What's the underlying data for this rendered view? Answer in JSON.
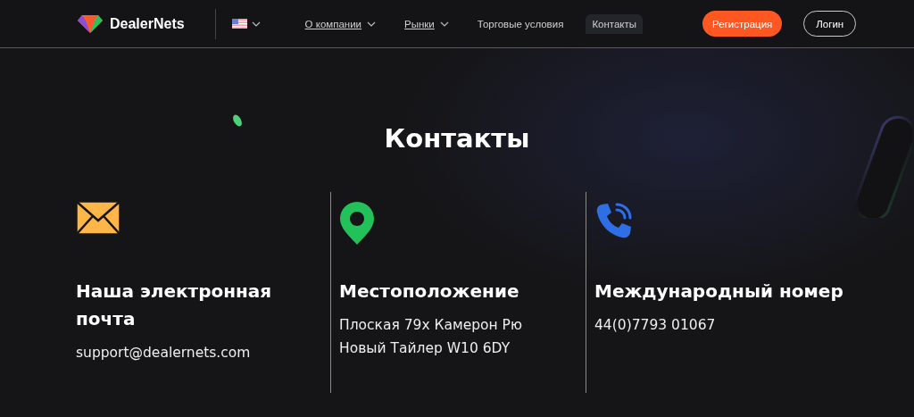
{
  "header": {
    "brand": "DealerNets",
    "nav": [
      {
        "label": "О компании",
        "dropdown": true,
        "selected": false
      },
      {
        "label": "Рынки",
        "dropdown": true,
        "selected": false
      },
      {
        "label": "Торговые условия",
        "dropdown": false,
        "selected": false
      },
      {
        "label": "Контакты",
        "dropdown": false,
        "selected": true
      }
    ],
    "buttons": [
      {
        "label": "Регистрация",
        "kind": "primary"
      },
      {
        "label": "Логин",
        "kind": "outline"
      }
    ]
  },
  "title": "Контакты",
  "contacts": [
    {
      "kind": "email",
      "heading": "Наша электронная почта",
      "lines": [
        "support@dealernets.com"
      ]
    },
    {
      "kind": "location",
      "heading": "Местоположение",
      "lines": [
        "Плоская 79х Камерон Рю",
        "Новый Тайлер W10 6DY"
      ]
    },
    {
      "kind": "phone",
      "heading": "Международный номер",
      "lines": [
        "44(0)7793 01067"
      ]
    }
  ]
}
